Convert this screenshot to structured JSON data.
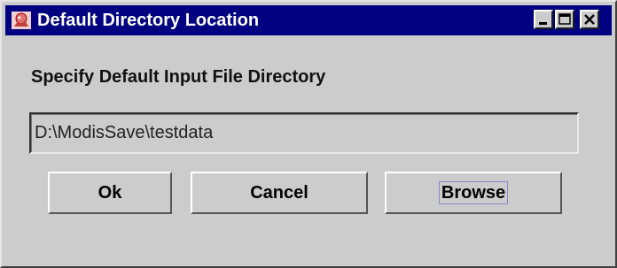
{
  "window": {
    "title": "Default Directory Location",
    "app_icon": "app-icon",
    "controls": {
      "minimize_icon": "minimize-icon",
      "maximize_icon": "maximize-icon",
      "close_icon": "close-icon"
    }
  },
  "dialog": {
    "heading": "Specify Default Input File Directory",
    "directory_value": "D:\\ModisSave\\testdata"
  },
  "buttons": {
    "ok_label": "Ok",
    "cancel_label": "Cancel",
    "browse_label": "Browse"
  },
  "colors": {
    "titlebar": "#000080",
    "window_bg": "#cccccc"
  }
}
